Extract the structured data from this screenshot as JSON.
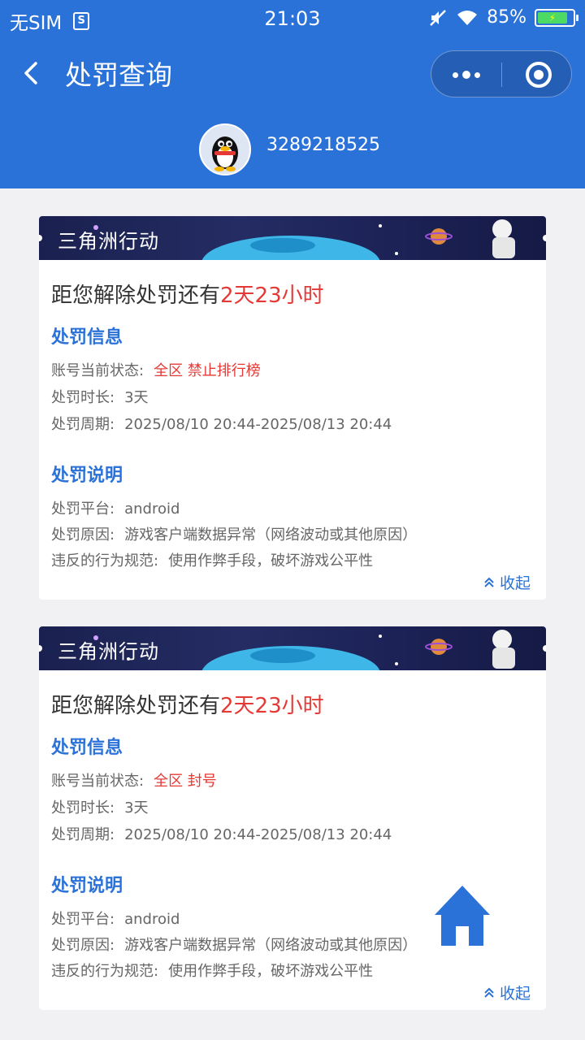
{
  "status_bar": {
    "carrier": "无SIM",
    "sim_icon_text": "S",
    "time": "21:03",
    "battery_percent": "85%",
    "battery_level": 0.85
  },
  "nav": {
    "title": "处罚查询"
  },
  "profile": {
    "account": "3289218525"
  },
  "cards": [
    {
      "banner_title": "三角洲行动",
      "countdown_prefix": "距您解除处罚还有",
      "countdown_value": "2天23小时",
      "info_title": "处罚信息",
      "status_label": "账号当前状态:",
      "status_value": "全区 禁止排行榜",
      "duration_label": "处罚时长:",
      "duration_value": "3天",
      "period_label": "处罚周期:",
      "period_value": "2025/08/10 20:44-2025/08/13 20:44",
      "desc_title": "处罚说明",
      "platform_label": "处罚平台:",
      "platform_value": "android",
      "reason_label": "处罚原因:",
      "reason_value": "游戏客户端数据异常（网络波动或其他原因）",
      "rule_label": "违反的行为规范:",
      "rule_value": "使用作弊手段，破坏游戏公平性",
      "collapse_label": "收起"
    },
    {
      "banner_title": "三角洲行动",
      "countdown_prefix": "距您解除处罚还有",
      "countdown_value": "2天23小时",
      "info_title": "处罚信息",
      "status_label": "账号当前状态:",
      "status_value": "全区 封号",
      "duration_label": "处罚时长:",
      "duration_value": "3天",
      "period_label": "处罚周期:",
      "period_value": "2025/08/10 20:44-2025/08/13 20:44",
      "desc_title": "处罚说明",
      "platform_label": "处罚平台:",
      "platform_value": "android",
      "reason_label": "处罚原因:",
      "reason_value": "游戏客户端数据异常（网络波动或其他原因）",
      "rule_label": "违反的行为规范:",
      "rule_value": "使用作弊手段，破坏游戏公平性",
      "collapse_label": "收起"
    }
  ],
  "colors": {
    "primary": "#2b72d8",
    "accent_red": "#e53935",
    "background": "#f1f1f3"
  }
}
